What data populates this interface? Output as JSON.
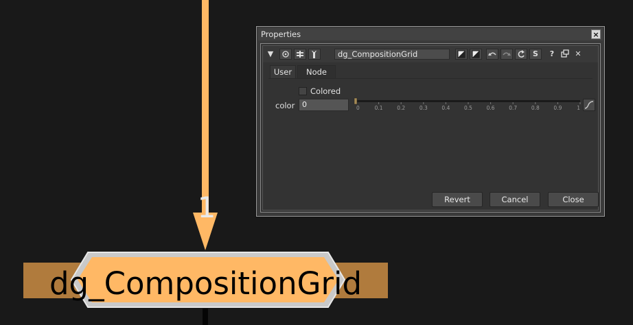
{
  "graph": {
    "input_label": "1",
    "node_title": "dg_CompositionGrid",
    "colors": {
      "edge": "#ffb865",
      "node_fill": "#ffb865",
      "backdrop": "#b07b3d"
    }
  },
  "properties": {
    "window_title": "Properties",
    "close_glyph": "×",
    "toolbar": {
      "collapse_glyph": "▼",
      "node_name": "dg_CompositionGrid",
      "help_glyph": "?",
      "float_glyph": "🗗",
      "close_glyph": "✕",
      "s_label": "S"
    },
    "tabs": [
      {
        "label": "User"
      },
      {
        "label": "Node"
      }
    ],
    "knobs": {
      "colored_label": "Colored",
      "colored_checked": false,
      "color_label": "color",
      "color_value": "0",
      "slider_ticks": [
        "0",
        "0.1",
        "0.2",
        "0.3",
        "0.4",
        "0.5",
        "0.6",
        "0.7",
        "0.8",
        "0.9",
        "1"
      ],
      "slider_value": 0
    },
    "buttons": {
      "revert": "Revert",
      "cancel": "Cancel",
      "close": "Close"
    }
  }
}
